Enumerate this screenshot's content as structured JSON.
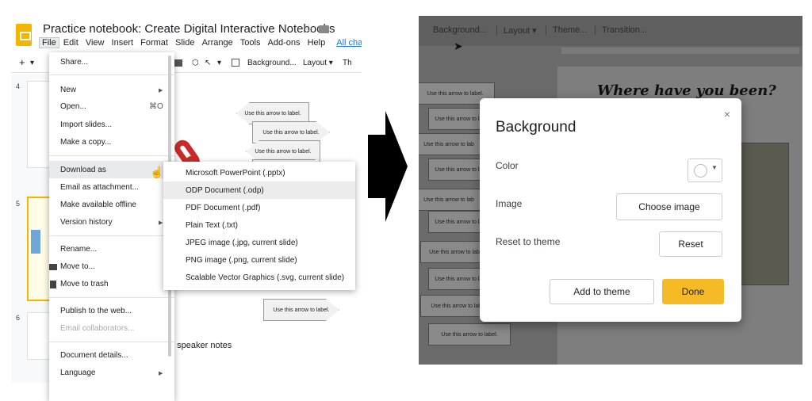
{
  "left": {
    "title": "Practice notebook: Create Digital Interactive Notebooks",
    "menubar": [
      "File",
      "Edit",
      "View",
      "Insert",
      "Format",
      "Slide",
      "Arrange",
      "Tools",
      "Add-ons",
      "Help"
    ],
    "menubar_link": "All change",
    "toolbar": {
      "background": "Background...",
      "layout": "Layout ▾",
      "theme_partial": "Th"
    },
    "slide_numbers": [
      "4",
      "5",
      "6"
    ],
    "arrow_label": "Use this arrow to label.",
    "speaker_notes": "d speaker notes",
    "file_menu": {
      "share": "Share...",
      "new": "New",
      "open": "Open...",
      "open_shortcut": "⌘O",
      "import_slides": "Import slides...",
      "make_copy": "Make a copy...",
      "download_as": "Download as",
      "email_attachment": "Email as attachment...",
      "make_offline": "Make available offline",
      "version_history": "Version history",
      "rename": "Rename...",
      "move_to": "Move to...",
      "move_to_trash": "Move to trash",
      "publish": "Publish to the web...",
      "email_collaborators": "Email collaborators...",
      "document_details": "Document details...",
      "language": "Language"
    },
    "download_submenu": [
      "Microsoft PowerPoint (.pptx)",
      "ODP Document (.odp)",
      "PDF Document (.pdf)",
      "Plain Text (.txt)",
      "JPEG image (.jpg, current slide)",
      "PNG image (.png, current slide)",
      "Scalable Vector Graphics (.svg, current slide)"
    ]
  },
  "right": {
    "toolbar": [
      "Background...",
      "Layout ▾",
      "Theme...",
      "Transition..."
    ],
    "slide_title": "Where have you been?",
    "arrow_label": "Use this arrow to label.",
    "arrow_label_partial": "Use this arrow to lab",
    "dialog": {
      "title": "Background",
      "close": "×",
      "color_label": "Color",
      "image_label": "Image",
      "reset_label": "Reset to theme",
      "choose_image": "Choose image",
      "reset": "Reset",
      "add_to_theme": "Add to theme",
      "done": "Done"
    }
  },
  "colors": {
    "accent": "#f6ba27",
    "doc_icon": "#f4b400",
    "clip": "#cc2a2a",
    "link": "#1a73e8"
  }
}
